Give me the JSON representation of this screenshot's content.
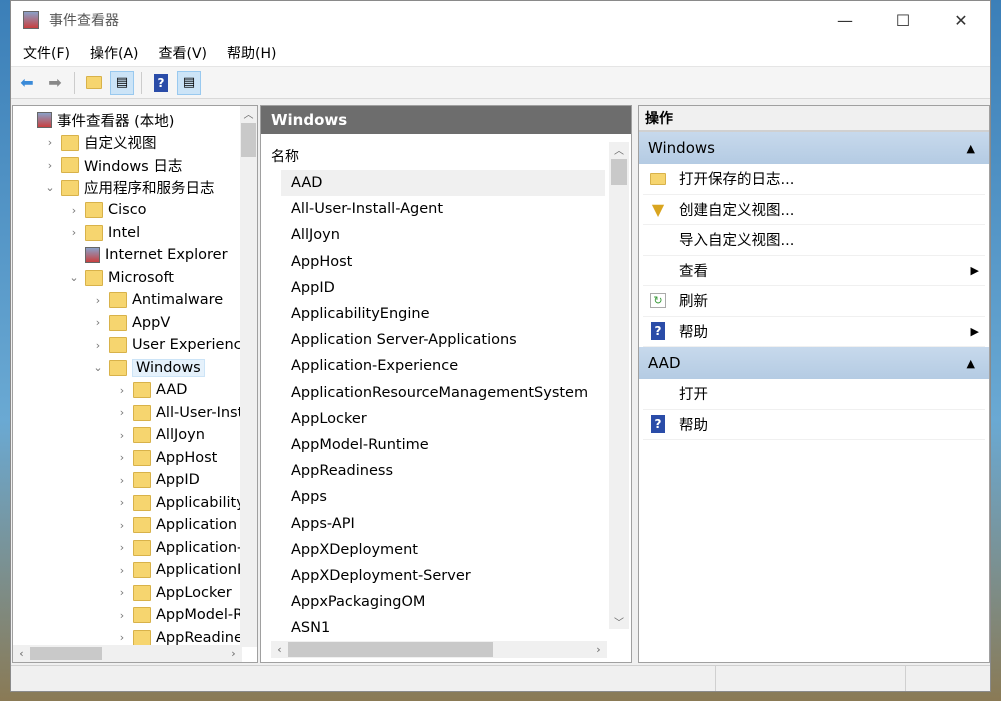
{
  "window": {
    "title": "事件查看器",
    "min": "—",
    "max": "☐",
    "close": "✕"
  },
  "menu": [
    "文件(F)",
    "操作(A)",
    "查看(V)",
    "帮助(H)"
  ],
  "tree": [
    {
      "label": "事件查看器 (本地)",
      "level": 0,
      "exp": "",
      "icon": "event-viewer"
    },
    {
      "label": "自定义视图",
      "level": 1,
      "exp": ">",
      "icon": "folder-filter"
    },
    {
      "label": "Windows 日志",
      "level": 1,
      "exp": ">",
      "icon": "folder-log"
    },
    {
      "label": "应用程序和服务日志",
      "level": 1,
      "exp": "v",
      "icon": "folder-log"
    },
    {
      "label": "Cisco",
      "level": 2,
      "exp": ">",
      "icon": "folder"
    },
    {
      "label": "Intel",
      "level": 2,
      "exp": ">",
      "icon": "folder"
    },
    {
      "label": "Internet Explorer",
      "level": 2,
      "exp": "",
      "icon": "log"
    },
    {
      "label": "Microsoft",
      "level": 2,
      "exp": "v",
      "icon": "folder"
    },
    {
      "label": "Antimalware",
      "level": 3,
      "exp": ">",
      "icon": "folder"
    },
    {
      "label": "AppV",
      "level": 3,
      "exp": ">",
      "icon": "folder"
    },
    {
      "label": "User Experience Virtualization",
      "level": 3,
      "exp": ">",
      "icon": "folder"
    },
    {
      "label": "Windows",
      "level": 3,
      "exp": "v",
      "icon": "folder",
      "selected": true
    },
    {
      "label": "AAD",
      "level": 4,
      "exp": ">",
      "icon": "folder"
    },
    {
      "label": "All-User-Install-Agent",
      "level": 4,
      "exp": ">",
      "icon": "folder"
    },
    {
      "label": "AllJoyn",
      "level": 4,
      "exp": ">",
      "icon": "folder"
    },
    {
      "label": "AppHost",
      "level": 4,
      "exp": ">",
      "icon": "folder"
    },
    {
      "label": "AppID",
      "level": 4,
      "exp": ">",
      "icon": "folder"
    },
    {
      "label": "ApplicabilityEngine",
      "level": 4,
      "exp": ">",
      "icon": "folder"
    },
    {
      "label": "Application Server-Applications",
      "level": 4,
      "exp": ">",
      "icon": "folder"
    },
    {
      "label": "Application-Experience",
      "level": 4,
      "exp": ">",
      "icon": "folder"
    },
    {
      "label": "ApplicationResourceManagementSystem",
      "level": 4,
      "exp": ">",
      "icon": "folder"
    },
    {
      "label": "AppLocker",
      "level": 4,
      "exp": ">",
      "icon": "folder"
    },
    {
      "label": "AppModel-Runtime",
      "level": 4,
      "exp": ">",
      "icon": "folder"
    },
    {
      "label": "AppReadiness",
      "level": 4,
      "exp": ">",
      "icon": "folder"
    }
  ],
  "middle": {
    "header": "Windows",
    "column": "名称",
    "items": [
      "AAD",
      "All-User-Install-Agent",
      "AllJoyn",
      "AppHost",
      "AppID",
      "ApplicabilityEngine",
      "Application Server-Applications",
      "Application-Experience",
      "ApplicationResourceManagementSystem",
      "AppLocker",
      "AppModel-Runtime",
      "AppReadiness",
      "Apps",
      "Apps-API",
      "AppXDeployment",
      "AppXDeployment-Server",
      "AppxPackagingOM",
      "ASN1"
    ]
  },
  "actions": {
    "header": "操作",
    "sections": [
      {
        "title": "Windows",
        "items": [
          {
            "label": "打开保存的日志...",
            "icon": "open-folder"
          },
          {
            "label": "创建自定义视图...",
            "icon": "filter"
          },
          {
            "label": "导入自定义视图...",
            "icon": ""
          },
          {
            "label": "查看",
            "icon": "",
            "submenu": true
          },
          {
            "label": "刷新",
            "icon": "refresh"
          },
          {
            "label": "帮助",
            "icon": "help",
            "submenu": true
          }
        ]
      },
      {
        "title": "AAD",
        "items": [
          {
            "label": "打开",
            "icon": ""
          },
          {
            "label": "帮助",
            "icon": "help"
          }
        ]
      }
    ]
  }
}
